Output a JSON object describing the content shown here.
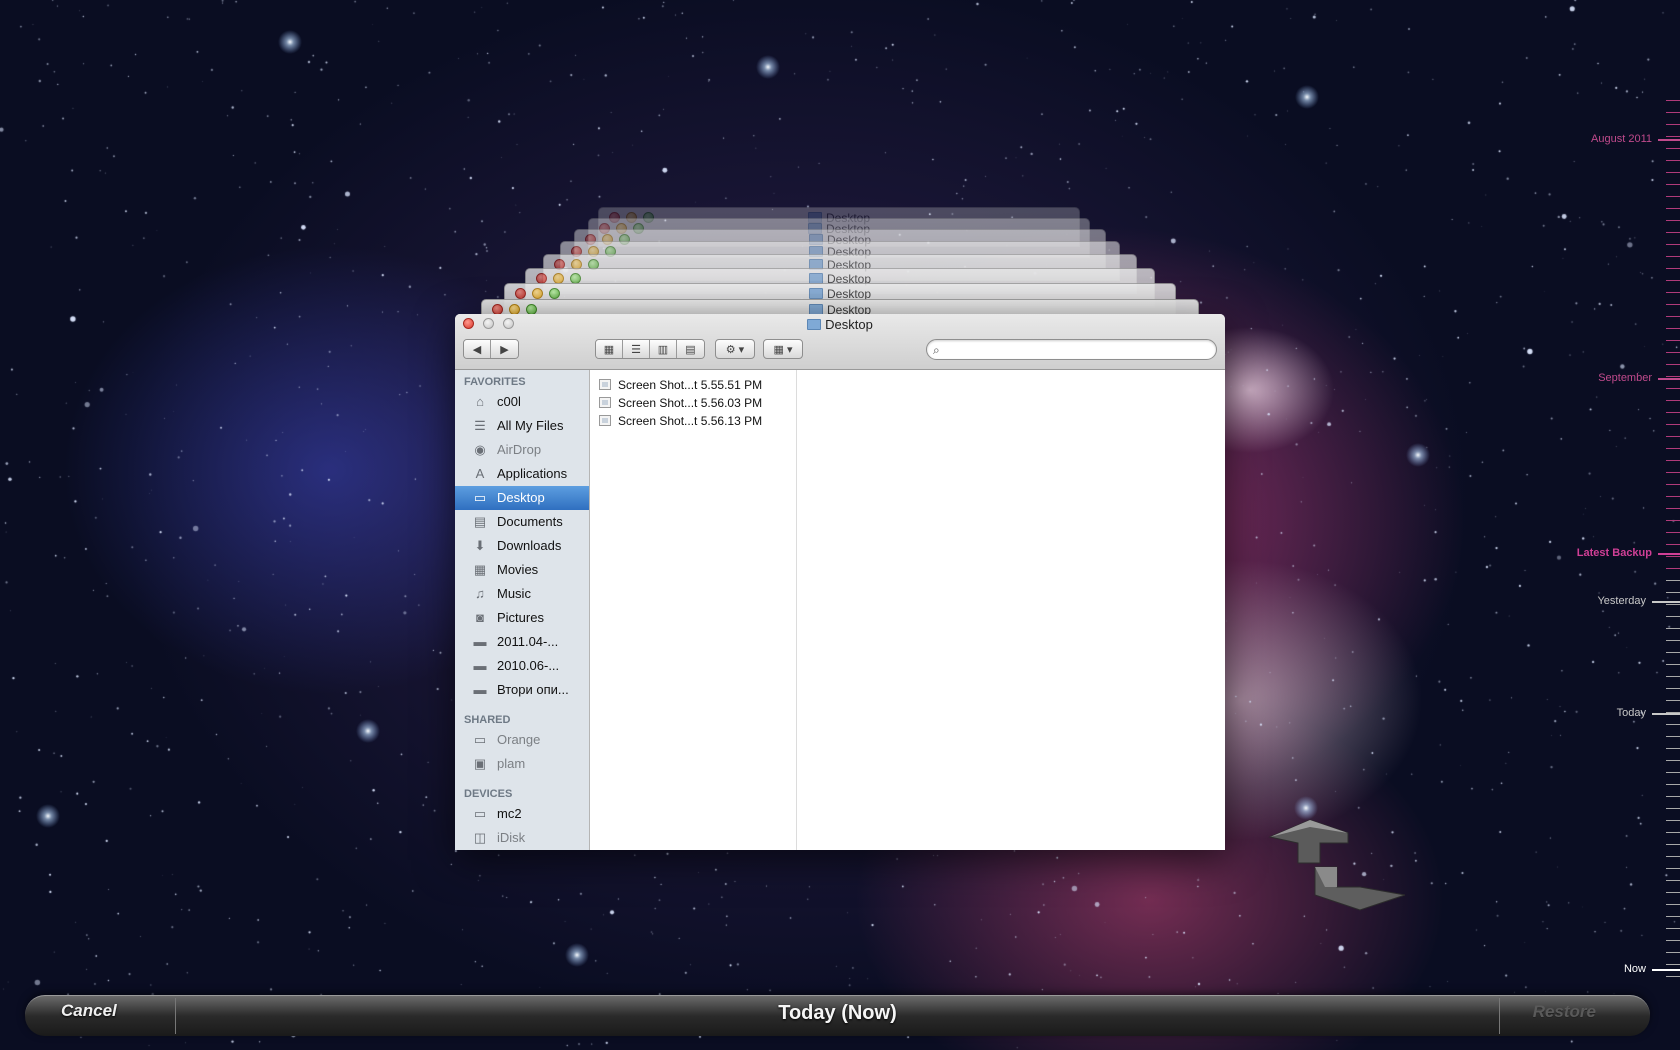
{
  "window": {
    "title": "Desktop",
    "ghost_title": "Desktop"
  },
  "toolbar": {
    "back_icon": "chevron-left-icon",
    "forward_icon": "chevron-right-icon",
    "view_modes": [
      "icon-view",
      "list-view",
      "column-view",
      "coverflow-view"
    ],
    "active_view": "column-view",
    "action_icon": "gear-icon",
    "arrange_icon": "grid-icon",
    "search_placeholder": ""
  },
  "sidebar": {
    "favorites_header": "FAVORITES",
    "favorites": [
      {
        "label": "c00l",
        "icon": "home-icon",
        "dim": false
      },
      {
        "label": "All My Files",
        "icon": "all-files-icon",
        "dim": false
      },
      {
        "label": "AirDrop",
        "icon": "airdrop-icon",
        "dim": true
      },
      {
        "label": "Applications",
        "icon": "applications-icon",
        "dim": false
      },
      {
        "label": "Desktop",
        "icon": "desktop-icon",
        "dim": false,
        "selected": true
      },
      {
        "label": "Documents",
        "icon": "documents-icon",
        "dim": false
      },
      {
        "label": "Downloads",
        "icon": "downloads-icon",
        "dim": false
      },
      {
        "label": "Movies",
        "icon": "movies-icon",
        "dim": false
      },
      {
        "label": "Music",
        "icon": "music-icon",
        "dim": false
      },
      {
        "label": "Pictures",
        "icon": "pictures-icon",
        "dim": false
      },
      {
        "label": "2011.04-...",
        "icon": "folder-icon",
        "dim": false
      },
      {
        "label": "2010.06-...",
        "icon": "folder-icon",
        "dim": false
      },
      {
        "label": "Втори опи...",
        "icon": "folder-icon",
        "dim": false
      }
    ],
    "shared_header": "SHARED",
    "shared": [
      {
        "label": "Orange",
        "icon": "server-icon",
        "dim": true
      },
      {
        "label": "plam",
        "icon": "computer-icon",
        "dim": true
      }
    ],
    "devices_header": "DEVICES",
    "devices": [
      {
        "label": "mc2",
        "icon": "laptop-icon",
        "dim": false
      },
      {
        "label": "iDisk",
        "icon": "idisk-icon",
        "dim": true
      }
    ]
  },
  "files": [
    "Screen Shot...t 5.55.51 PM",
    "Screen Shot...t 5.56.03 PM",
    "Screen Shot...t 5.56.13 PM"
  ],
  "timeline": {
    "labels": [
      {
        "text": "August 2011",
        "color": "#c04a8c"
      },
      {
        "text": "September",
        "color": "#c04a8c"
      },
      {
        "text": "Latest Backup",
        "color": "#d03f96"
      },
      {
        "text": "Yesterday",
        "color": "#c8c8c8"
      },
      {
        "text": "Today",
        "color": "#c8c8c8"
      },
      {
        "text": "Now",
        "color": "#ffffff"
      }
    ]
  },
  "bottom_bar": {
    "cancel": "Cancel",
    "title": "Today (Now)",
    "restore": "Restore"
  },
  "colors": {
    "selection": "#3b7fd0",
    "timeline_accent": "#b03a7a"
  }
}
